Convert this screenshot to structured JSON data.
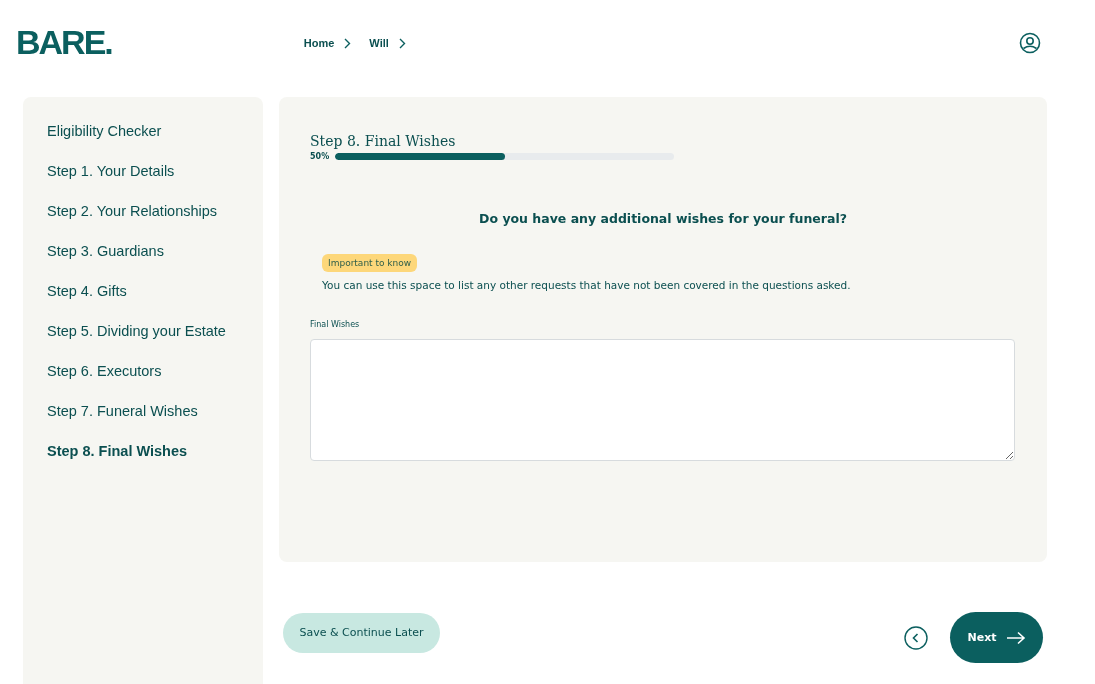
{
  "header": {
    "logo": "BARE.",
    "breadcrumb": [
      {
        "label": "Home"
      },
      {
        "label": "Will"
      }
    ]
  },
  "sidebar": {
    "items": [
      {
        "label": "Eligibility Checker",
        "selected": false
      },
      {
        "label": "Step 1. Your Details",
        "selected": false
      },
      {
        "label": "Step 2. Your Relationships",
        "selected": false
      },
      {
        "label": "Step 3. Guardians",
        "selected": false
      },
      {
        "label": "Step 4. Gifts",
        "selected": false
      },
      {
        "label": "Step 5. Dividing your Estate",
        "selected": false
      },
      {
        "label": "Step 6. Executors",
        "selected": false
      },
      {
        "label": "Step 7. Funeral Wishes",
        "selected": false
      },
      {
        "label": "Step 8. Final Wishes",
        "selected": true
      }
    ]
  },
  "step": {
    "title": "Step 8. Final Wishes",
    "progress": {
      "reading": "50%",
      "level": 0.5
    }
  },
  "question": "Do you have any additional wishes for your funeral?",
  "notice": {
    "badge": "Important to know",
    "text": "You can use this space to list any other requests that have not been covered in the questions asked."
  },
  "field": {
    "label": "Final Wishes"
  },
  "buttons": {
    "save": "Save & Continue Later",
    "next": "Next"
  }
}
